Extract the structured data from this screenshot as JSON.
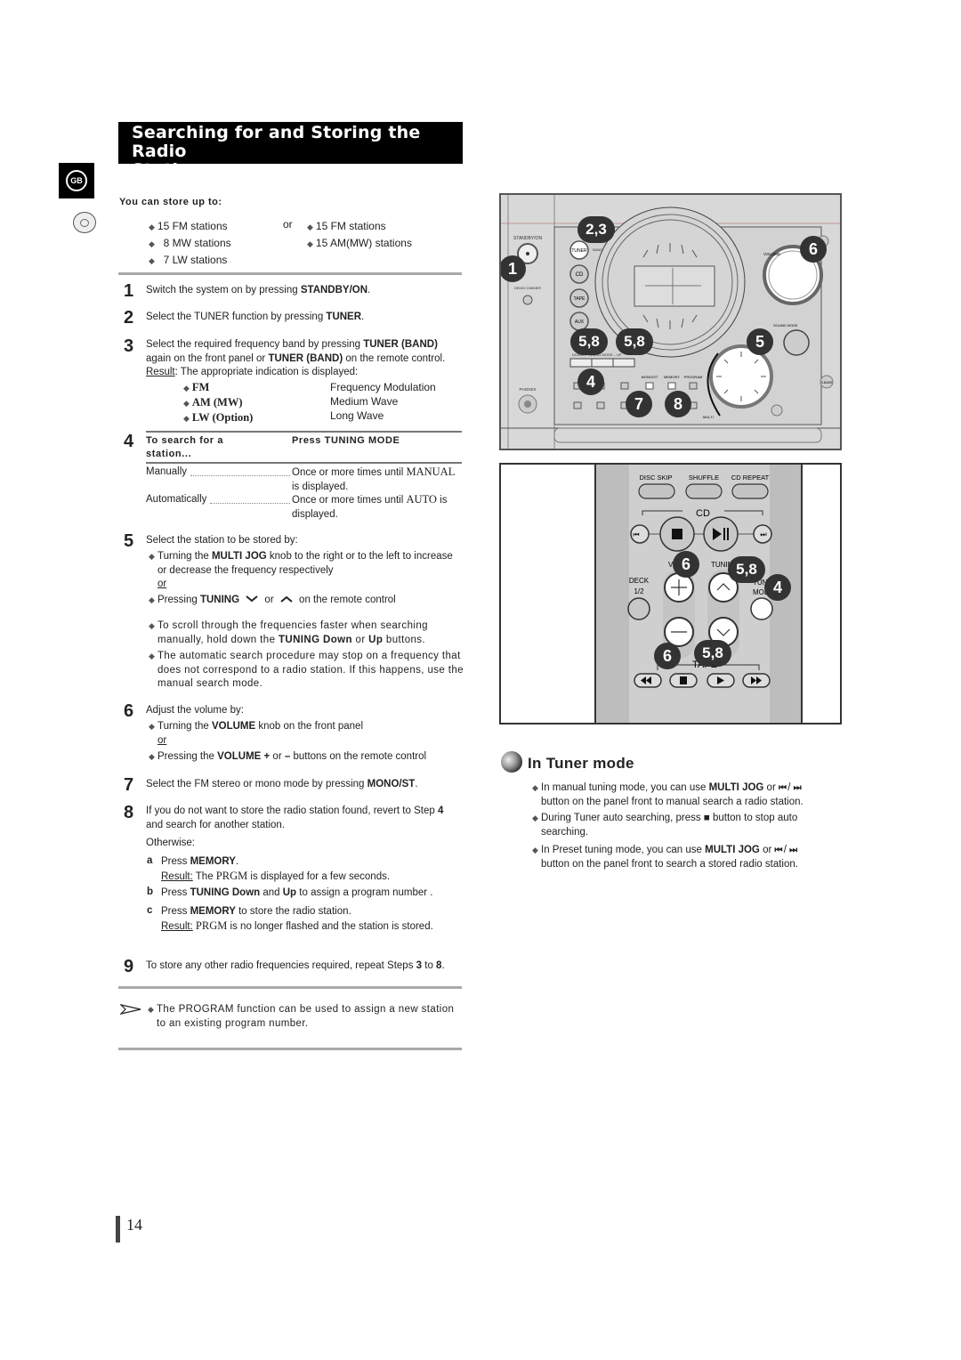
{
  "page": {
    "title_line1": "Searching for and Storing the Radio",
    "title_line2": "Stations",
    "language_tab": "GB",
    "page_number": "14"
  },
  "store": {
    "heading": "You can store up to:",
    "left": [
      "15 FM stations",
      " 8 MW stations",
      " 7 LW stations"
    ],
    "or": "or",
    "right": [
      "15 FM stations",
      "15 AM(MW) stations"
    ]
  },
  "steps": {
    "s1": {
      "num": "1",
      "pre": "Switch the system on by pressing ",
      "bold": "STANDBY/ON",
      "post": "."
    },
    "s2": {
      "num": "2",
      "pre": "Select the TUNER function by pressing ",
      "bold": "TUNER",
      "post": "."
    },
    "s3": {
      "num": "3",
      "l1_pre": "Select the required frequency band by pressing ",
      "l1_bold": "TUNER (BAND)",
      "l2_pre": "again on the front panel or ",
      "l2_bold": "TUNER (BAND)",
      "l2_post": " on the remote control.",
      "result_label": "Result",
      "result_text": ": The appropriate indication is displayed:",
      "bands": [
        {
          "code": "FM",
          "name": "Frequency Modulation"
        },
        {
          "code": "AM (MW)",
          "name": "Medium Wave"
        },
        {
          "code": "LW (Option)",
          "name": "Long Wave"
        }
      ]
    },
    "s4": {
      "num": "4",
      "col1_head_l1": "To search for a",
      "col1_head_l2": "station...",
      "col2_head": "Press TUNING MODE",
      "rows": [
        {
          "label": "Manually",
          "pre": "Once or more times until ",
          "mode": "MANUAL",
          "l2": "is displayed."
        },
        {
          "label": "Automatically",
          "pre": "Once or more times until ",
          "mode": "AUTO",
          "post": " is",
          "l2": "displayed."
        }
      ]
    },
    "s5": {
      "num": "5",
      "intro": "Select the station to be stored by:",
      "b1_pre": "Turning the ",
      "b1_bold": "MULTI JOG",
      "b1_post": " knob to the right or to the left to increase",
      "b1_l2": "or decrease the frequency respectively",
      "or": "or",
      "b2_pre": "Pressing ",
      "b2_bold": "TUNING",
      "b2_mid": " or ",
      "b2_post": " on the remote control",
      "b3_l1": "To scroll through the frequencies faster when searching",
      "b3_l2_pre": "manually, hold down the ",
      "b3_l2_bold1": "TUNING Down",
      "b3_l2_mid": " or ",
      "b3_l2_bold2": "Up",
      "b3_l2_post": " buttons.",
      "b4_l1": "The automatic search procedure may stop on a frequency that",
      "b4_l2": "does not correspond to a radio station. If this happens, use the",
      "b4_l3": "manual search mode."
    },
    "s6": {
      "num": "6",
      "intro": "Adjust the volume by:",
      "b1_pre": "Turning the ",
      "b1_bold": "VOLUME",
      "b1_post": " knob on the front panel",
      "or": "or",
      "b2_pre": "Pressing the ",
      "b2_bold": "VOLUME +",
      "b2_mid": " or ",
      "b2_bold2": "–",
      "b2_post": " buttons on the remote control"
    },
    "s7": {
      "num": "7",
      "pre": "Select the FM stereo or mono mode by pressing ",
      "bold": "MONO/ST",
      "post": "."
    },
    "s8": {
      "num": "8",
      "l1_pre": "If you do not want to store the radio station found, revert to Step ",
      "l1_bold": "4",
      "l2": "and search for another station.",
      "otherwise": "Otherwise:",
      "a_letter": "a",
      "a_pre": "Press ",
      "a_bold": "MEMORY",
      "a_post": ".",
      "a_result_label": "Result:",
      "a_result_pre": " The ",
      "a_result_code": "PRGM",
      "a_result_post": " is displayed for a few seconds.",
      "b_letter": "b",
      "b_pre": "Press ",
      "b_bold1": "TUNING Down",
      "b_mid": " and ",
      "b_bold2": "Up",
      "b_post": " to assign a program number .",
      "c_letter": "c",
      "c_pre": "Press ",
      "c_bold": "MEMORY",
      "c_post": " to store the radio station.",
      "c_result_label": "Result:",
      "c_result_code": " PRGM",
      "c_result_post": " is no longer flashed and the station is stored."
    },
    "s9": {
      "num": "9",
      "pre": "To store any other radio frequencies required, repeat Steps ",
      "bold1": "3",
      "mid": " to ",
      "bold2": "8",
      "post": "."
    }
  },
  "note": {
    "l1": "The PROGRAM function can be used to assign a new station",
    "l2": "to an existing program number."
  },
  "front_panel": {
    "labels": {
      "standby": "STANDBY/ON",
      "demo": "DEMO/ DIMMER",
      "tuner": "TUNER",
      "band": "BAND",
      "cd": "CD",
      "tape": "TAPE",
      "aux": "AUX",
      "phones": "PHONES",
      "volume": "VOLUME",
      "sound_mode": "SOUND MODE",
      "bass": "S.BASS",
      "tuning_mode": "DOWN – TUNING MODE – UP",
      "mono": "MONO/ST",
      "memory": "MEMORY",
      "program": "PROGRAM",
      "multi": "MULTI"
    },
    "callouts": [
      "2,3",
      "1",
      "6",
      "5,8",
      "5,8",
      "5",
      "4",
      "7",
      "8"
    ]
  },
  "remote": {
    "labels": {
      "disc_skip": "DISC SKIP",
      "shuffle": "SHUFFLE",
      "cd_repeat": "CD REPEAT",
      "cd": "CD",
      "vol": "VOL",
      "tuning": "TUNING",
      "deck": "DECK",
      "deck_sub": "1/2",
      "tuning_mode": "TUNING MODE",
      "tape": "TAPE"
    },
    "callouts": [
      "6",
      "5,8",
      "4",
      "6",
      "5,8"
    ]
  },
  "tuner_mode": {
    "title": "In Tuner mode",
    "b1_pre": "In manual tuning mode, you can use ",
    "b1_bold": "MULTI JOG",
    "b1_mid": " or ",
    "b1_l2": "button on the panel front to manual search a radio station.",
    "b2_pre": "During Tuner auto searching, press ",
    "b2_post": " button to stop auto",
    "b2_l2": "searching.",
    "b3_pre": "In Preset tuning mode, you can use ",
    "b3_bold": "MULTI JOG",
    "b3_mid": " or ",
    "b3_l2": "button on the panel front to search a stored radio station.",
    "prev_glyph": "⏮",
    "next_glyph": "⏭",
    "stop_glyph": "■",
    "slash": "/"
  }
}
